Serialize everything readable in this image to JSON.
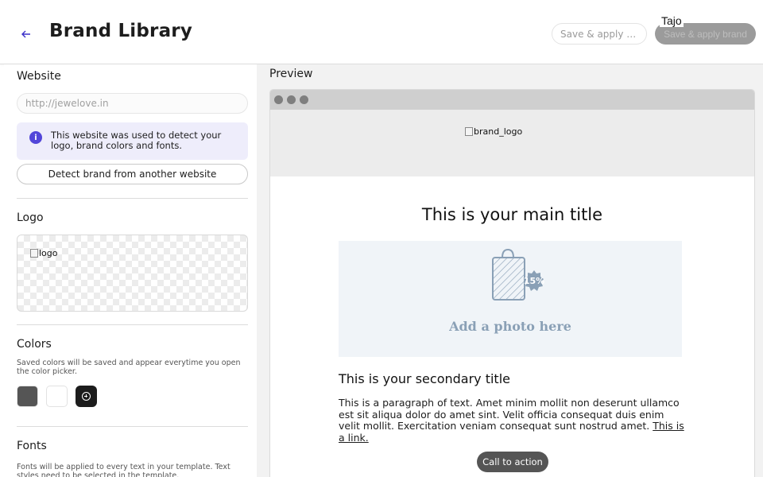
{
  "header": {
    "back_icon": "back-arrow-icon",
    "title": "Brand Library",
    "name_placeholder": "Save & apply la...",
    "apply_label": "Save & apply brand",
    "user_name": "Tajo",
    "apply_color": "#9b9b9b"
  },
  "sidebar": {
    "website": {
      "title": "Website",
      "url_placeholder": "http://jewelove.in",
      "info_icon": "info-icon",
      "info_text": "This website was used to detect your logo, brand colors and fonts.",
      "detect_label": "Detect brand from another website"
    },
    "logo": {
      "title": "Logo",
      "alt": "logo"
    },
    "colors": {
      "title": "Colors",
      "hint": "Saved colors will be saved and appear everytime you open the color picker.",
      "swatches": [
        "#555555",
        "#ffffff"
      ],
      "add_icon": "add-circle-icon"
    },
    "fonts": {
      "title": "Fonts",
      "hint": "Fonts will be applied to every text in your template. Text styles need to be selected in the template."
    }
  },
  "preview": {
    "label": "Preview",
    "brand_logo_alt": "brand_logo",
    "main_title": "This is your main title",
    "photo_icon": "shopping-bag-discount-icon",
    "photo_badge": "15%",
    "photo_text": "Add a photo here",
    "secondary_title": "This is your secondary title",
    "paragraph": "This is a paragraph of text. Amet minim mollit non deserunt ullamco est sit aliqua dolor do amet sint. Velit officia consequat duis enim velit mollit. Exercitation veniam consequat sunt nostrud amet.",
    "link_text": "This is a link.",
    "cta_label": "Call to action",
    "cta_color": "#555555"
  }
}
